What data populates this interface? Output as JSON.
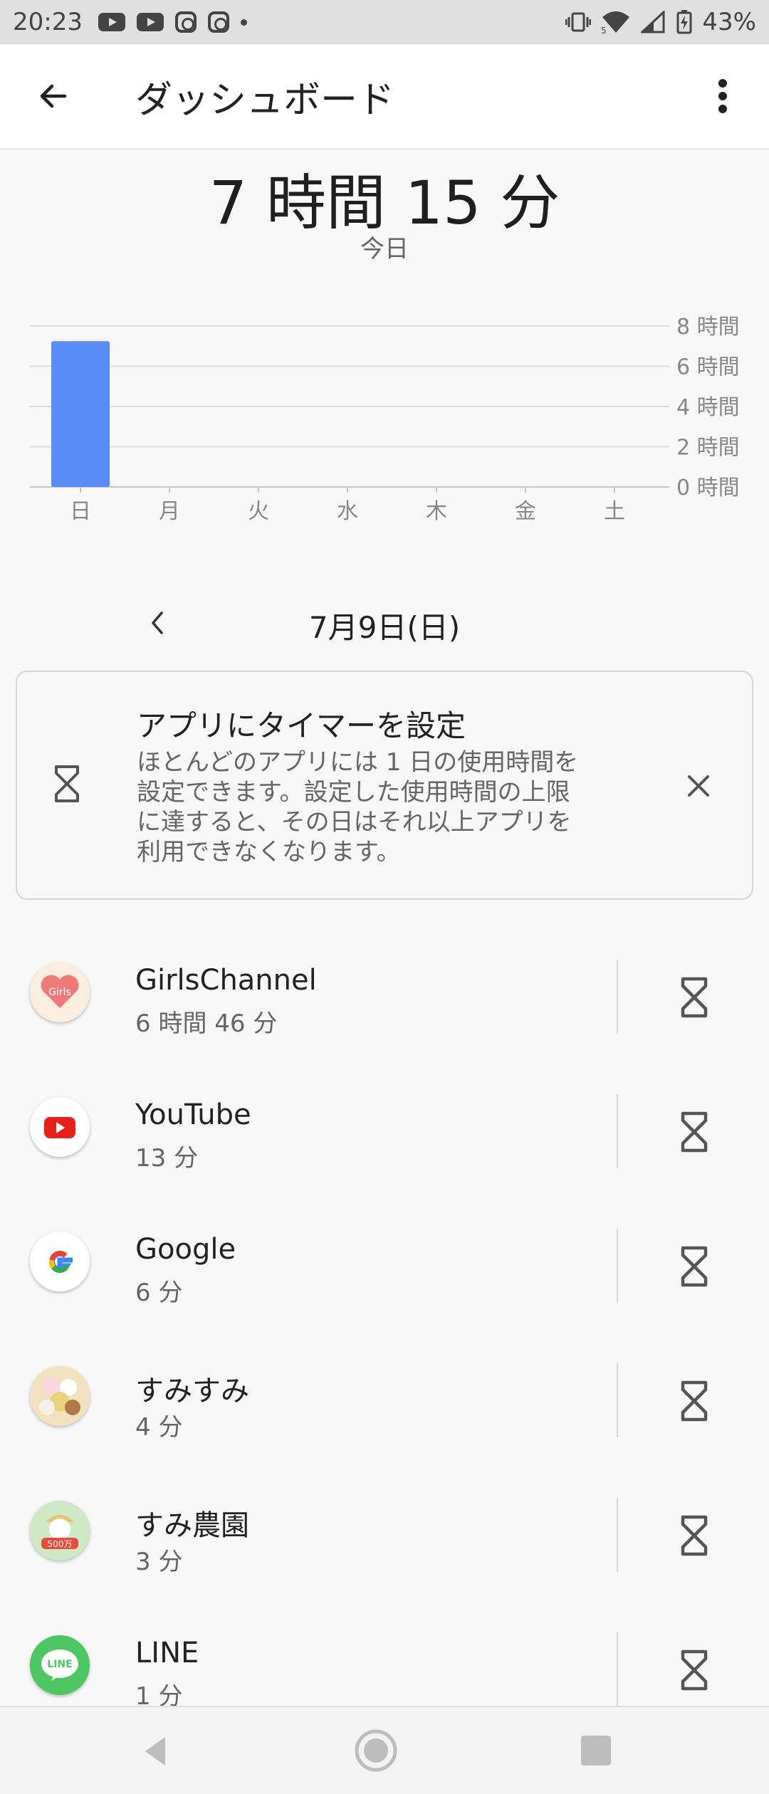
{
  "status_bar": {
    "time": "20:23",
    "battery": "43%"
  },
  "app_bar": {
    "title": "ダッシュボード"
  },
  "summary": {
    "total": "7 時間 15 分",
    "period": "今日"
  },
  "chart_data": {
    "type": "bar",
    "categories": [
      "日",
      "月",
      "火",
      "水",
      "木",
      "金",
      "土"
    ],
    "values": [
      7.25,
      0,
      0,
      0,
      0,
      0,
      0
    ],
    "ylim": [
      0,
      8
    ],
    "y_ticks": [
      {
        "value": 8,
        "label": "8 時間"
      },
      {
        "value": 6,
        "label": "6 時間"
      },
      {
        "value": 4,
        "label": "4 時間"
      },
      {
        "value": 2,
        "label": "2 時間"
      },
      {
        "value": 0,
        "label": "0 時間"
      }
    ],
    "bar_color": "#5a8cf8",
    "grid": true,
    "y_axis_side": "right"
  },
  "date_nav": {
    "label": "7月9日(日)"
  },
  "timer_card": {
    "title": "アプリにタイマーを設定",
    "body_lines": [
      "ほとんどのアプリには 1 日の使用時間を",
      "設定できます。設定した使用時間の上限",
      "に達すると、その日はそれ以上アプリを",
      "利用できなくなります。"
    ]
  },
  "apps": [
    {
      "name": "GirlsChannel",
      "time": "6 時間 46 分",
      "icon": "girlschannel-icon"
    },
    {
      "name": "YouTube",
      "time": "13 分",
      "icon": "youtube-icon"
    },
    {
      "name": "Google",
      "time": "6 分",
      "icon": "google-icon"
    },
    {
      "name": "すみすみ",
      "time": "4 分",
      "icon": "sumisumi-icon"
    },
    {
      "name": "すみ農園",
      "time": "3 分",
      "icon": "sumi-farm-icon"
    },
    {
      "name": "LINE",
      "time": "1 分",
      "icon": "line-icon"
    }
  ],
  "icon_labels": {
    "girls": "Girls",
    "line": "LINE",
    "sumi_farm": "500万"
  },
  "colors": {
    "accent": "#5a8cf8",
    "youtube": "#e62117",
    "line": "#4cc764"
  }
}
